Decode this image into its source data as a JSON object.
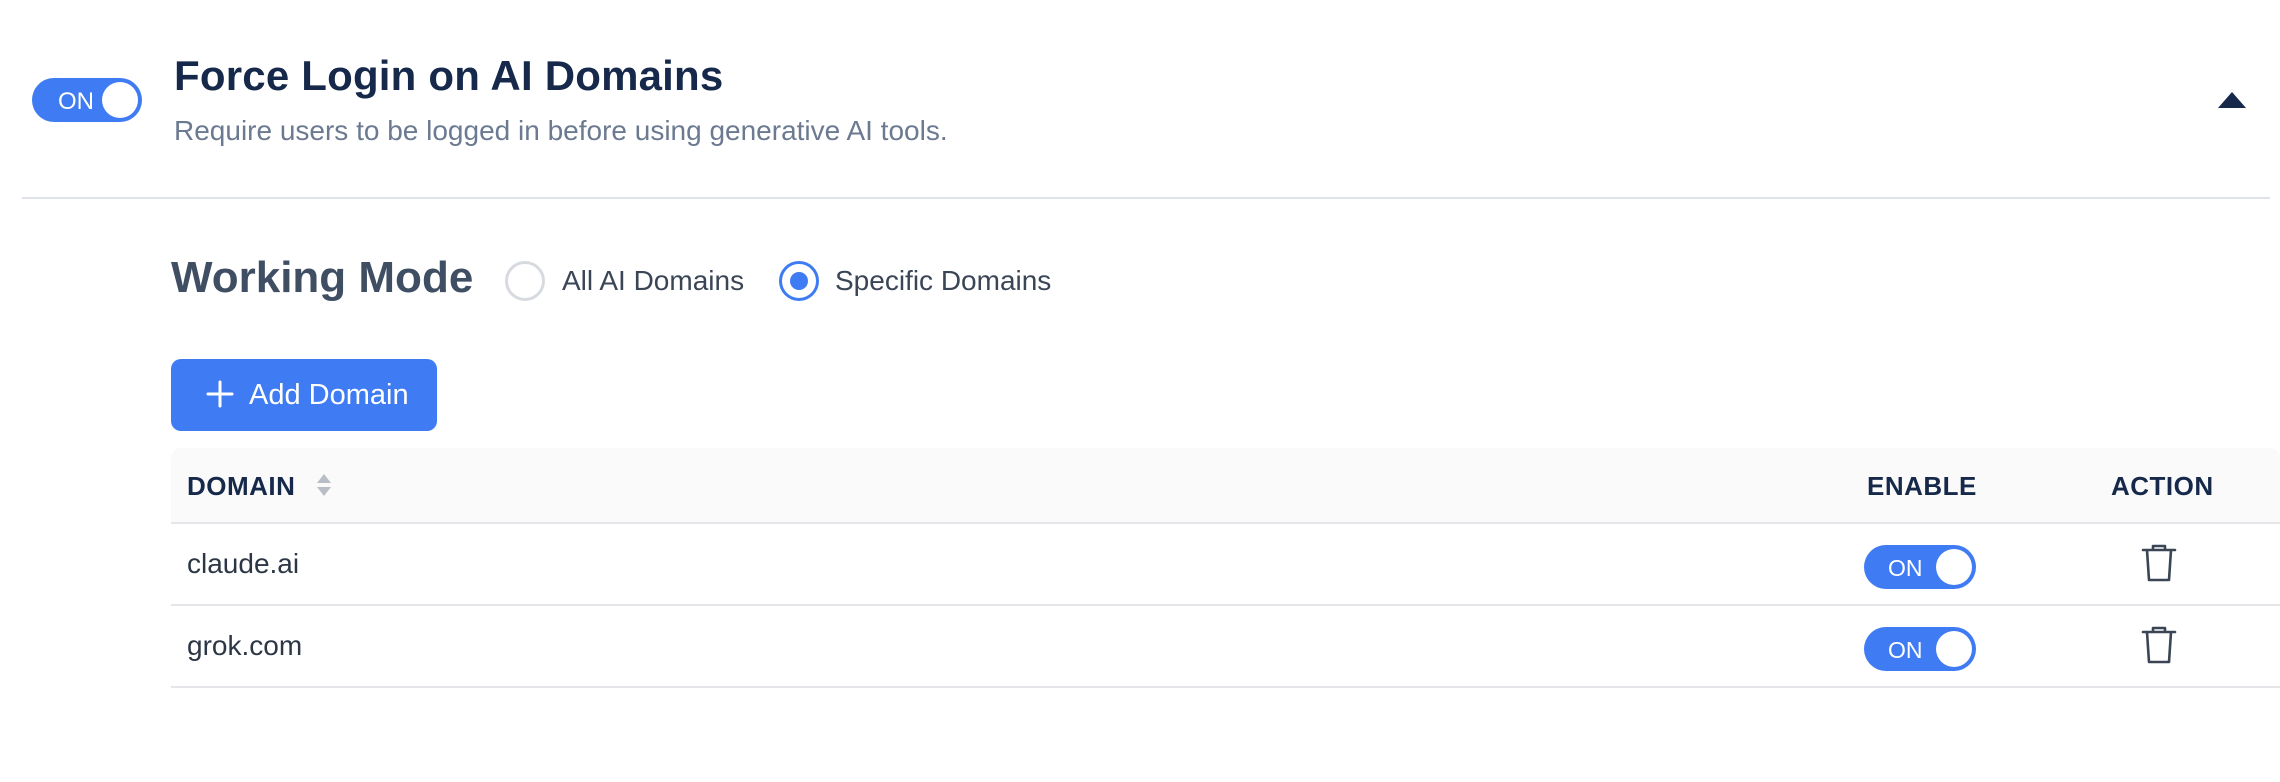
{
  "header": {
    "toggle_label": "ON",
    "toggle_state": true,
    "title": "Force Login on AI Domains",
    "subtitle": "Require users to be logged in before using generative AI tools.",
    "collapse_icon": "caret-up-icon"
  },
  "working_mode": {
    "label": "Working Mode",
    "options": [
      {
        "label": "All AI Domains",
        "selected": false
      },
      {
        "label": "Specific Domains",
        "selected": true
      }
    ]
  },
  "add_button": {
    "label": "Add Domain",
    "icon": "plus-icon"
  },
  "table": {
    "columns": {
      "domain": "DOMAIN",
      "enable": "ENABLE",
      "action": "ACTION"
    },
    "rows": [
      {
        "domain": "claude.ai",
        "enable_label": "ON",
        "enabled": true,
        "action_icon": "trash-icon"
      },
      {
        "domain": "grok.com",
        "enable_label": "ON",
        "enabled": true,
        "action_icon": "trash-icon"
      }
    ]
  },
  "colors": {
    "accent": "#3f7bf3",
    "title": "#16294a",
    "subtitle": "#6b7a90",
    "divider": "#dfe3e8"
  }
}
